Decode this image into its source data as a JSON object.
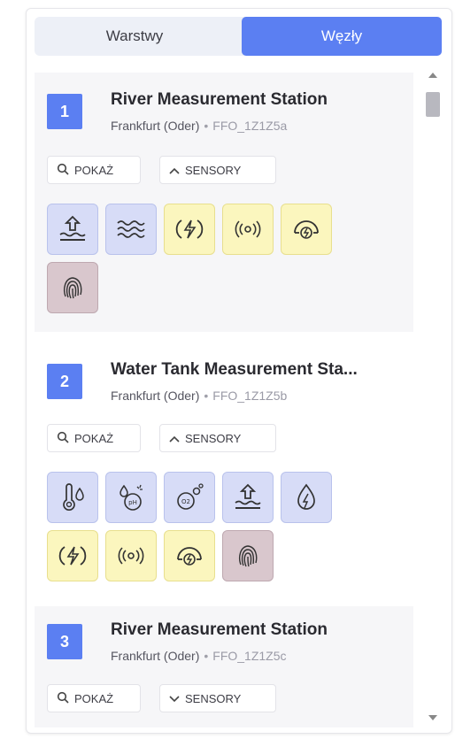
{
  "tabs": {
    "layers": "Warstwy",
    "nodes": "Węzły"
  },
  "buttons": {
    "show": "POKAŻ",
    "sensors": "SENSORY"
  },
  "nodes": [
    {
      "num": "1",
      "title": "River Measurement Station",
      "city": "Frankfurt (Oder)",
      "code": "FFO_1Z1Z5a",
      "sensors": [
        "water-level-icon",
        "waves-icon",
        "power-icon",
        "signal-icon",
        "battery-gauge-icon",
        "fingerprint-icon"
      ]
    },
    {
      "num": "2",
      "title": "Water Tank Measurement Sta...",
      "city": "Frankfurt (Oder)",
      "code": "FFO_1Z1Z5b",
      "sensors": [
        "temperature-icon",
        "ph-icon",
        "oxygen-icon",
        "water-level-icon",
        "conductivity-icon",
        "power-icon",
        "signal-icon",
        "battery-gauge-icon",
        "fingerprint-icon"
      ]
    },
    {
      "num": "3",
      "title": "River Measurement Station",
      "city": "Frankfurt (Oder)",
      "code": "FFO_1Z1Z5c",
      "sensors": []
    }
  ],
  "colors": {
    "accent": "#5b7ff2",
    "sensor_blue": "#d7dcf7",
    "sensor_yellow": "#fbf6be",
    "sensor_pink": "#d9c7cd"
  }
}
